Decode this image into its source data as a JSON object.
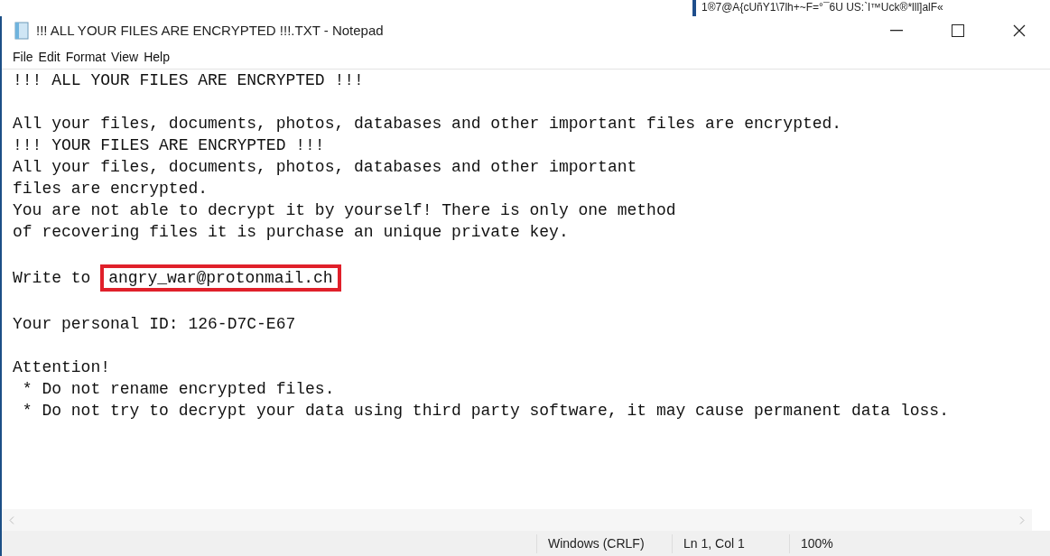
{
  "background_window": {
    "text": "1®7@A{cUñY1\\7lh+~F=°¯6U US:`l™Uck®*lll]alF«"
  },
  "window": {
    "title": "!!! ALL YOUR FILES ARE ENCRYPTED !!!.TXT - Notepad"
  },
  "menu": [
    "File",
    "Edit",
    "Format",
    "View",
    "Help"
  ],
  "paragraphs": [
    [
      {
        "text": "!!! ALL YOUR FILES ARE ENCRYPTED !!!"
      }
    ],
    [
      {
        "text": "All your files, documents, photos, databases and other important files are encrypted."
      },
      {
        "text": "!!! YOUR FILES ARE ENCRYPTED !!!"
      },
      {
        "text": "All your files, documents, photos, databases and other important"
      },
      {
        "text": "files are encrypted."
      },
      {
        "text": "You are not able to decrypt it by yourself! There is only one method"
      },
      {
        "text": "of recovering files it is purchase an unique private key."
      }
    ],
    [
      {
        "text": "Write to",
        "boxed": "angry_war@protonmail.ch"
      }
    ],
    [
      {
        "text": "Your personal ID: 126-D7C-E67"
      }
    ],
    [
      {
        "text": "Attention!"
      },
      {
        "text": " * Do not rename encrypted files."
      },
      {
        "text": " * Do not try to decrypt your data using third party software, it may cause permanent data loss."
      }
    ]
  ],
  "status_bar": [
    "Windows (CRLF)",
    "Ln 1, Col 1",
    "100%"
  ]
}
